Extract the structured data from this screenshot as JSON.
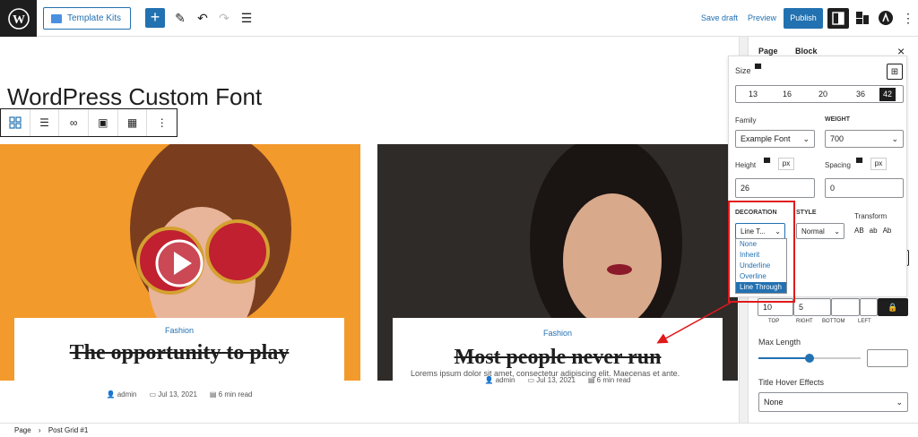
{
  "topbar": {
    "template_kits_label": "Template Kits",
    "save_draft_label": "Save draft",
    "preview_label": "Preview",
    "publish_label": "Publish"
  },
  "editor": {
    "page_title": "WordPress Custom Font",
    "posts": [
      {
        "category": "Fashion",
        "title": "The opportunity to play",
        "author": "admin",
        "date": "Jul 13, 2021",
        "read_time": "6 min read"
      },
      {
        "category": "Fashion",
        "title": "Most people never run",
        "author": "admin",
        "date": "Jul 13, 2021",
        "read_time": "6 min read",
        "excerpt": "Lorems ipsum dolor sit amet, consectetur adipiscing elit. Maecenas et ante."
      }
    ]
  },
  "sidebar": {
    "tab_page": "Page",
    "tab_block": "Block",
    "close_label": "×",
    "size_label": "Size",
    "size_options": [
      "13",
      "16",
      "20",
      "36",
      "42"
    ],
    "family_label": "Family",
    "family_value": "Example Font",
    "weight_label": "WEIGHT",
    "weight_value": "700",
    "height_label": "Height",
    "height_unit": "px",
    "height_value": "26",
    "spacing_label": "Spacing",
    "spacing_unit": "px",
    "spacing_value": "0",
    "decoration_label": "DECORATION",
    "decoration_value": "Line T...",
    "style_label": "STYLE",
    "style_value": "Normal",
    "transform_label": "Transform",
    "transform_options": [
      "AB",
      "ab",
      "Ab"
    ],
    "decoration_options": [
      "None",
      "Inherit",
      "Underline",
      "Overline",
      "Line Through"
    ],
    "typography_partial": "phy",
    "px_label": "px",
    "padding_values": [
      "10",
      "5",
      "",
      ""
    ],
    "padding_labels": [
      "TOP",
      "RIGHT",
      "BOTTOM",
      "LEFT"
    ],
    "max_length_label": "Max Length",
    "max_length_fraction": 0.5,
    "title_hover_label": "Title Hover Effects",
    "title_hover_value": "None"
  },
  "statusbar": {
    "crumb_page": "Page",
    "crumb_block": "Post Grid #1"
  },
  "colors": {
    "accent": "#2271b1",
    "highlight_red": "#e0191b",
    "orange_bg": "#f39a2c"
  }
}
